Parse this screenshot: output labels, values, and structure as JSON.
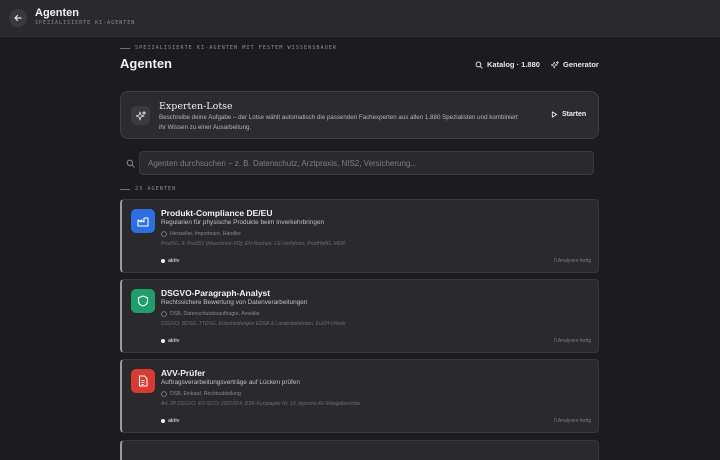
{
  "header": {
    "title": "Agenten",
    "subtitle": "SPEZIALISIERTE KI-AGENTEN"
  },
  "hero": {
    "eyebrow": "SPEZIALISIERTE KI-AGENTEN MIT FESTEM WISSENSBAUER",
    "title": "Agenten"
  },
  "actions": {
    "catalog_label": "Katalog · 1.880",
    "generator_label": "Generator"
  },
  "lotse": {
    "title": "Experten-Lotse",
    "description": "Beschreibe deine Aufgabe – der Lotse wählt automatisch die passenden Fachexperten aus allen 1.880 Spezialisten und kombiniert ihr Wissen zu einer Ausarbeitung.",
    "start_label": "Starten"
  },
  "search": {
    "placeholder": "Agenten durchsuchen – z. B. Datenschutz, Arztpraxis, NIS2, Versicherung..."
  },
  "list": {
    "count_label": "23 AGENTEN"
  },
  "agents": [
    {
      "title": "Produkt-Compliance DE/EU",
      "subtitle": "Regularien für physische Produkte beim Inverkehrbringen",
      "audience": "Hersteller, Importeure, Händler",
      "references": "ProdSG, 8. ProdSV (Maschinen-VO), EN-Normen, CE-Verfahren, ProdHaftG, MDR",
      "status": "aktiv",
      "count": "0 Analysen fertig",
      "icon": "factory-icon",
      "color": "#2d6fe0"
    },
    {
      "title": "DSGVO-Paragraph-Analyst",
      "subtitle": "Rechtssichere Bewertung von Datenverarbeitungen",
      "audience": "DSB, Datenschutzbeauftragte, Anwälte",
      "references": "DSGVO, BDSG, TTDSG, Entscheidungen EDSA & Landesbehörden, EuGH-Urteile",
      "status": "aktiv",
      "count": "0 Analysen fertig",
      "icon": "shield-icon",
      "color": "#1e9e6c"
    },
    {
      "title": "AVV-Prüfer",
      "subtitle": "Auftragsverarbeitungsverträge auf Lücken prüfen",
      "audience": "DSB, Einkauf, Rechtsabteilung",
      "references": "Art. 28 DSGVO, EU-SCCs 2021/914, DSK-Kurzpapier Nr. 13, typische AV-Mängelberichte",
      "status": "aktiv",
      "count": "0 Analysen fertig",
      "icon": "document-icon",
      "color": "#d83a34"
    }
  ],
  "colors": {
    "background": "#1c1c1e",
    "card": "#2a2a2d",
    "topbar": "#2a2a2d"
  }
}
